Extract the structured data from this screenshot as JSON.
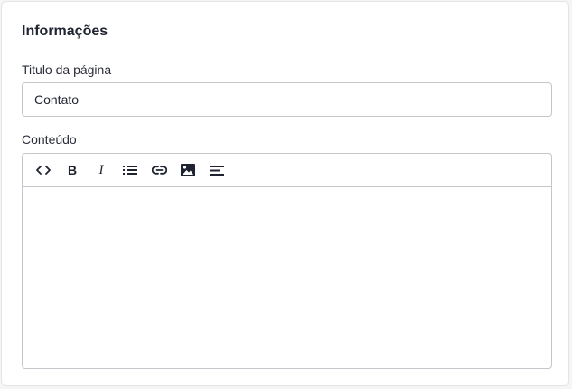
{
  "section": {
    "title": "Informações"
  },
  "page_title_field": {
    "label": "Titulo da página",
    "value": "Contato"
  },
  "content_field": {
    "label": "Conteúdo",
    "toolbar": {
      "code_icon": "code-icon",
      "bold_label": "B",
      "italic_label": "I",
      "list_icon": "bulleted-list-icon",
      "link_icon": "link-icon",
      "image_icon": "image-icon",
      "align_icon": "align-left-icon"
    },
    "value": ""
  }
}
